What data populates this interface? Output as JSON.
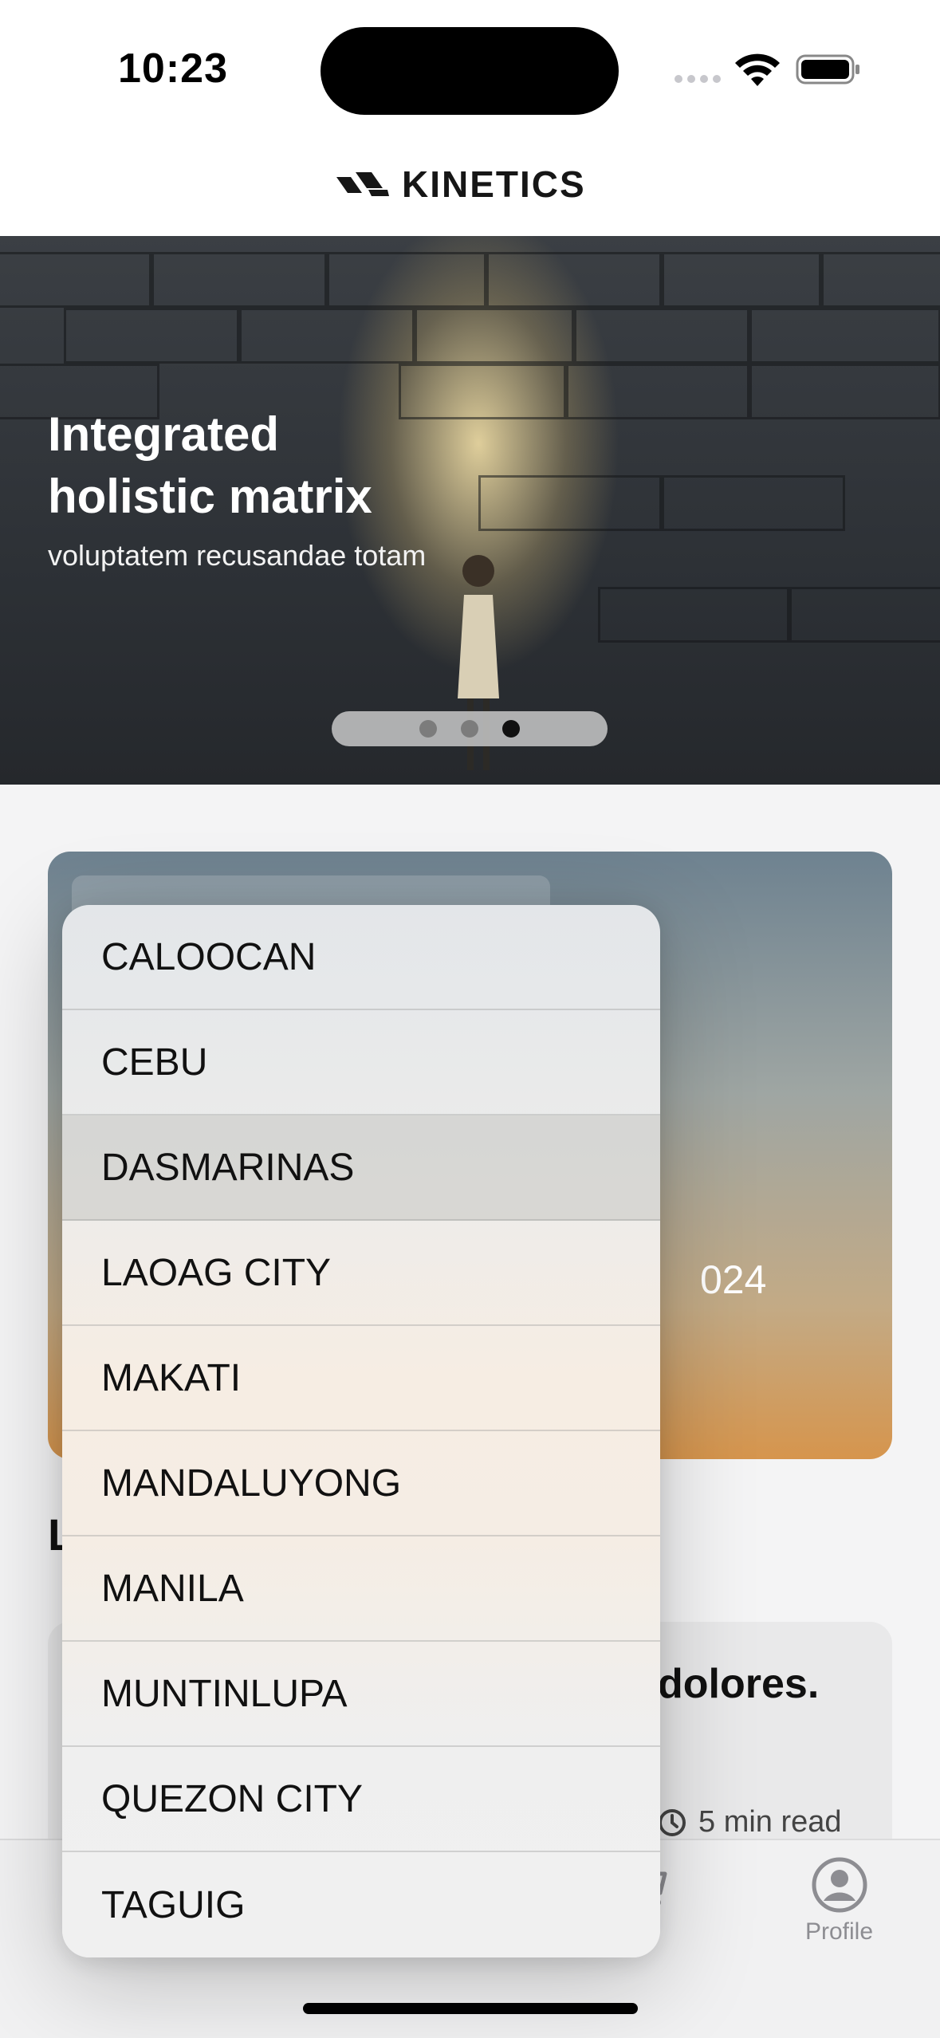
{
  "status_bar": {
    "time": "10:23"
  },
  "header": {
    "brand": "KINETICS"
  },
  "hero": {
    "title_line1": "Integrated",
    "title_line2": "holistic matrix",
    "subtitle": "voluptatem recusandae totam",
    "pagination": {
      "count": 3,
      "active_index": 2
    }
  },
  "event_card": {
    "year_fragment": "024"
  },
  "section": {
    "heading_fragment": "L"
  },
  "article": {
    "title_fragment": "dolores.",
    "read_time": "5 min read"
  },
  "tab_bar": {
    "tabs": [
      {
        "label": "art",
        "icon": "cart-icon"
      },
      {
        "label": "Profile",
        "icon": "profile-icon"
      }
    ]
  },
  "dropdown": {
    "items": [
      "CALOOCAN",
      "CEBU",
      "DASMARINAS",
      "LAOAG CITY",
      "MAKATI",
      "MANDALUYONG",
      "MANILA",
      "MUNTINLUPA",
      "QUEZON CITY",
      "TAGUIG"
    ],
    "highlighted": "DASMARINAS"
  },
  "colors": {
    "accent": "#d6954d",
    "card_top": "#6e8290"
  }
}
